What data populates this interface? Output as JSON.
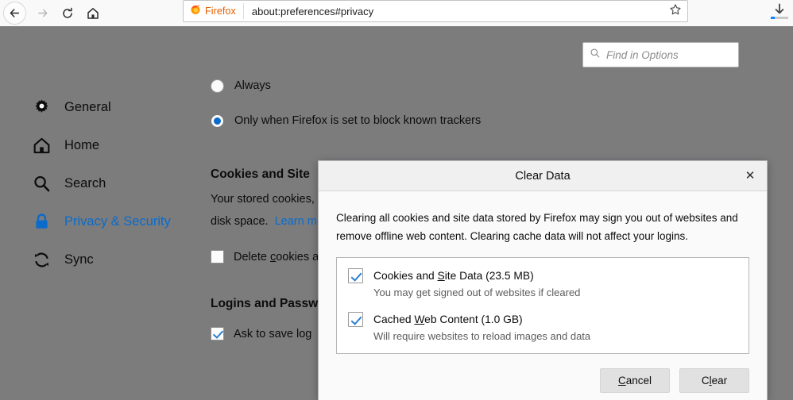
{
  "browser": {
    "nav": {
      "back": "back-arrow",
      "forward": "forward-arrow",
      "reload": "reload",
      "home": "home"
    },
    "identity_label": "Firefox",
    "url": "about:preferences#privacy",
    "bookmark_icon": "star-icon",
    "downloads_icon": "download-icon"
  },
  "preferences": {
    "search": {
      "placeholder": "Find in Options",
      "value": ""
    },
    "sidebar": {
      "items": [
        {
          "label": "General",
          "icon": "gear-icon",
          "active": false
        },
        {
          "label": "Home",
          "icon": "home-icon",
          "active": false
        },
        {
          "label": "Search",
          "icon": "search-icon",
          "active": false
        },
        {
          "label": "Privacy & Security",
          "icon": "lock-icon",
          "active": true
        },
        {
          "label": "Sync",
          "icon": "sync-icon",
          "active": false
        }
      ]
    },
    "main": {
      "radios": [
        {
          "label": "Always",
          "selected": false
        },
        {
          "label": "Only when Firefox is set to block known trackers",
          "selected": true
        }
      ],
      "cookies_section": {
        "heading": "Cookies and Site",
        "body_line1": "Your stored cookies,",
        "body_line2_pre": "disk space.",
        "body_line2_link": "Learn m",
        "checkbox": {
          "label_pre": "Delete ",
          "label_accesskey": "c",
          "label_post": "ookies a",
          "checked": false
        }
      },
      "logins_section": {
        "heading": "Logins and Passw",
        "checkbox": {
          "label": "Ask to save log",
          "checked": true
        }
      }
    }
  },
  "dialog": {
    "title": "Clear Data",
    "close_icon": "close-icon",
    "description": "Clearing all cookies and site data stored by Firefox may sign you out of websites and remove offline web content. Clearing cache data will not affect your logins.",
    "options": [
      {
        "label_pre": "Cookies and ",
        "label_accesskey": "S",
        "label_post": "ite Data (23.5 MB)",
        "sublabel": "You may get signed out of websites if cleared",
        "checked": true
      },
      {
        "label_pre": "Cached ",
        "label_accesskey": "W",
        "label_post": "eb Content (1.0 GB)",
        "sublabel": "Will require websites to reload images and data",
        "checked": true
      }
    ],
    "buttons": [
      {
        "label_pre": "",
        "label_accesskey": "C",
        "label_post": "ancel",
        "name": "cancel"
      },
      {
        "label_pre": "C",
        "label_accesskey": "l",
        "label_post": "ear",
        "name": "clear"
      }
    ]
  },
  "colors": {
    "accent": "#0a6bcb",
    "firefox_orange": "#e66000",
    "check_blue": "#2b7dd0",
    "overlay": "rgba(0,0,0,0.5)"
  }
}
